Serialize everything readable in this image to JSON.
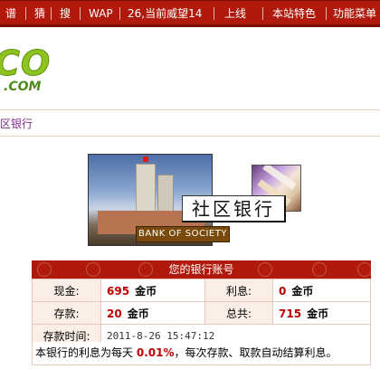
{
  "topnav": {
    "items": [
      "谱",
      "猜",
      "搜",
      "WAP",
      "26,当前威望14",
      "上线",
      "本站特色",
      "功能菜单"
    ]
  },
  "logo": {
    "letters": "CO",
    "suffix": ".COM"
  },
  "breadcrumb": {
    "text": "区银行"
  },
  "banner": {
    "title": "社区银行",
    "subtitle": "BANK OF SOCIETY"
  },
  "account": {
    "header": "您的银行账号",
    "cash_label": "现金:",
    "cash_value": "695",
    "cash_unit": "金币",
    "interest_label": "利息:",
    "interest_value": "0",
    "interest_unit": "金币",
    "deposit_label": "存款:",
    "deposit_value": "20",
    "deposit_unit": "金币",
    "total_label": "总共:",
    "total_value": "715",
    "total_unit": "金币",
    "time_label": "存款时间:",
    "time_value": "2011-8-26 15:47:12"
  },
  "note": {
    "prefix": "本银行的利息为每天",
    "rate": "0.01%",
    "suffix": "，每次存款、取款自动结算利息。"
  },
  "colors": {
    "nav_red": "#b01a0c",
    "value_red": "#c00000",
    "logo_green": "#8fc31f"
  }
}
